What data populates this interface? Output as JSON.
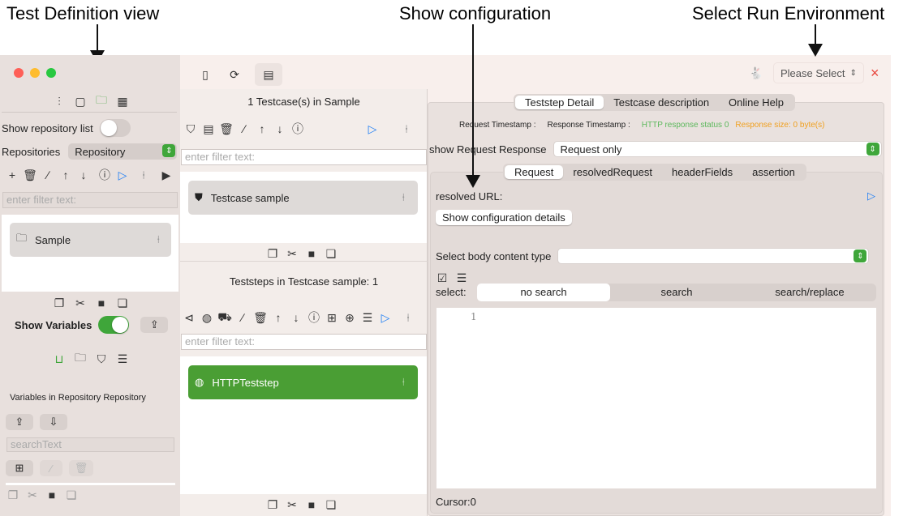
{
  "annotations": {
    "test_definition": "Test Definition view",
    "show_configuration": "Show configuration",
    "select_env": "Select Run Environment"
  },
  "toolbar": {
    "env_select": "Please Select",
    "close": "×"
  },
  "sidebar": {
    "show_repo_list": "Show repository list",
    "repositories_label": "Repositories",
    "repositories_value": "Repository",
    "filter_placeholder": "enter filter text:",
    "items": [
      {
        "label": "Sample"
      }
    ],
    "show_variables": "Show Variables",
    "variables_in": "Variables in  Repository Repository",
    "search_placeholder": "searchText"
  },
  "middle": {
    "testcases_title": "1 Testcase(s) in Sample",
    "filter_placeholder": "enter filter text:",
    "testcases": [
      {
        "label": "Testcase sample"
      }
    ],
    "teststeps_title": "Teststeps in Testcase sample: 1",
    "teststeps": [
      {
        "label": "HTTPTeststep"
      }
    ]
  },
  "detail": {
    "tabs": [
      {
        "label": "Teststep Detail"
      },
      {
        "label": "Testcase description"
      },
      {
        "label": "Online Help"
      }
    ],
    "request_timestamp": "Request Timestamp :",
    "response_timestamp": "Response Timestamp :",
    "http_status": "HTTP response status 0",
    "response_size": "Response size: 0 byte(s)",
    "show_req_resp_label": "show Request Response",
    "show_req_resp_value": "Request only",
    "subtabs": [
      {
        "label": "Request"
      },
      {
        "label": "resolvedRequest"
      },
      {
        "label": "headerFields"
      },
      {
        "label": "assertion"
      }
    ],
    "resolved_url": "resolved URL:",
    "show_config_button": "Show configuration details",
    "body_type_label": "Select body content type",
    "body_type_value": "",
    "select_label": "select:",
    "search_modes": [
      {
        "label": "no search"
      },
      {
        "label": "search"
      },
      {
        "label": "search/replace"
      }
    ],
    "line_number": "1",
    "cursor": "Cursor:0"
  },
  "colors": {
    "accent_green": "#3fa63a",
    "status_green": "#5cb85c",
    "size_orange": "#f0a020",
    "play_blue": "#1a7cf5",
    "close_red": "#e8453c"
  }
}
